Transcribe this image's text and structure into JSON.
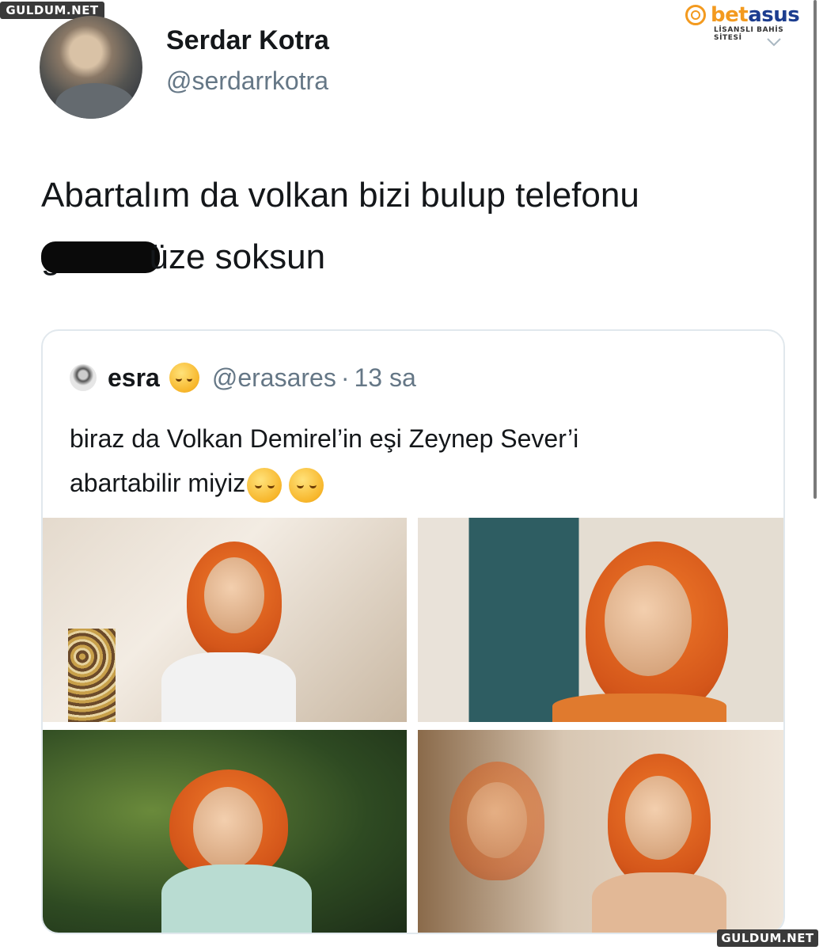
{
  "watermark": {
    "top_left": "GULDUM.NET",
    "bottom_right": "GULDUM.NET"
  },
  "brand": {
    "name_part1": "bet",
    "name_part2": "asus",
    "subtitle": "LİSANSLI BAHİS SİTESİ",
    "colors": {
      "orange": "#f39a1f",
      "blue": "#1c3d8f"
    }
  },
  "tweet": {
    "display_name": "Serdar Kotra",
    "handle": "@serdarrkotra",
    "text_line1": "Abartalım da volkan bizi bulup telefonu",
    "text_line2_prefix": "g",
    "text_line2_suffix": "üze soksun",
    "menu_icon": "chevron-down-icon"
  },
  "quote": {
    "display_name": "esra",
    "name_emoji": "pleading-face-emoji",
    "handle": "@erasares",
    "separator": "·",
    "time": "13 sa",
    "text_line1": "biraz da Volkan Demirel’in eşi Zeynep Sever’i",
    "text_line2": "abartabilir miyiz",
    "text_emojis": [
      "relieved-face-emoji",
      "relieved-face-emoji"
    ],
    "photo_count": 4
  },
  "colors": {
    "text": "#14171a",
    "secondary": "#657786",
    "border": "#e1e8ed"
  }
}
